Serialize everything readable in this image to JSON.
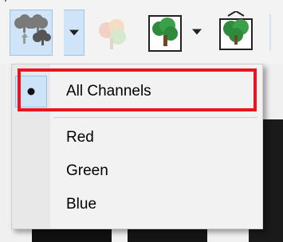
{
  "toolbar": {
    "buttons": [
      {
        "name": "channels-tree-icon",
        "state": "pressed"
      },
      {
        "name": "channels-dropdown-arrow",
        "state": "pressed"
      },
      {
        "name": "pastel-tree-icon",
        "state": "disabled"
      },
      {
        "name": "image-tree-icon",
        "state": "normal"
      },
      {
        "name": "image-dropdown-arrow",
        "state": "normal"
      },
      {
        "name": "fit-tree-icon",
        "state": "normal"
      }
    ]
  },
  "channel_menu": {
    "items": [
      {
        "label": "All Channels",
        "selected": true
      },
      {
        "label": "Red",
        "selected": false
      },
      {
        "label": "Green",
        "selected": false
      },
      {
        "label": "Blue",
        "selected": false
      }
    ]
  },
  "colors": {
    "accent_pressed": "#cfe4f7",
    "highlight_border": "#e8141f",
    "tree_green": "#2e8b3c"
  }
}
